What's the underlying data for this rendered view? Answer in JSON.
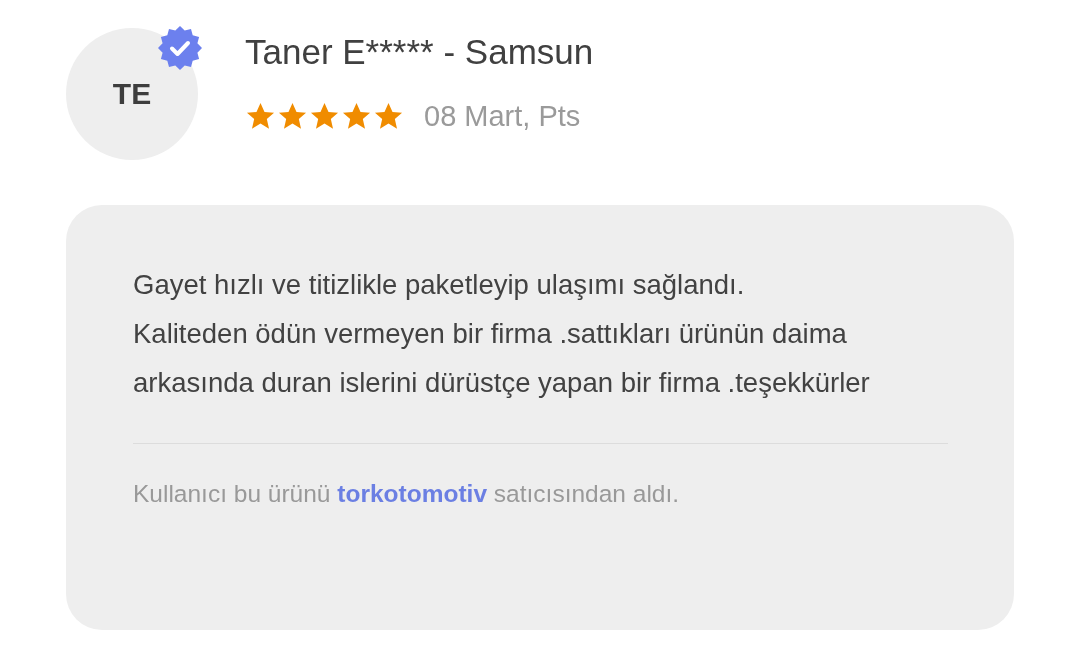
{
  "review": {
    "avatar_initials": "TE",
    "verified": true,
    "author": "Taner E***** - Samsun",
    "stars": 5,
    "date": "08 Mart, Pts",
    "text": "Gayet hızlı ve titizlikle paketleyip ulaşımı sağlandı.\nKaliteden ödün vermeyen bir firma .sattıkları ürünün daima arkasında duran islerini dürüstçe yapan bir firma .teşekkürler",
    "seller_note": {
      "before": "Kullanıcı bu ürünü",
      "seller": "torkotomotiv",
      "after": "satıcısından aldı."
    }
  }
}
